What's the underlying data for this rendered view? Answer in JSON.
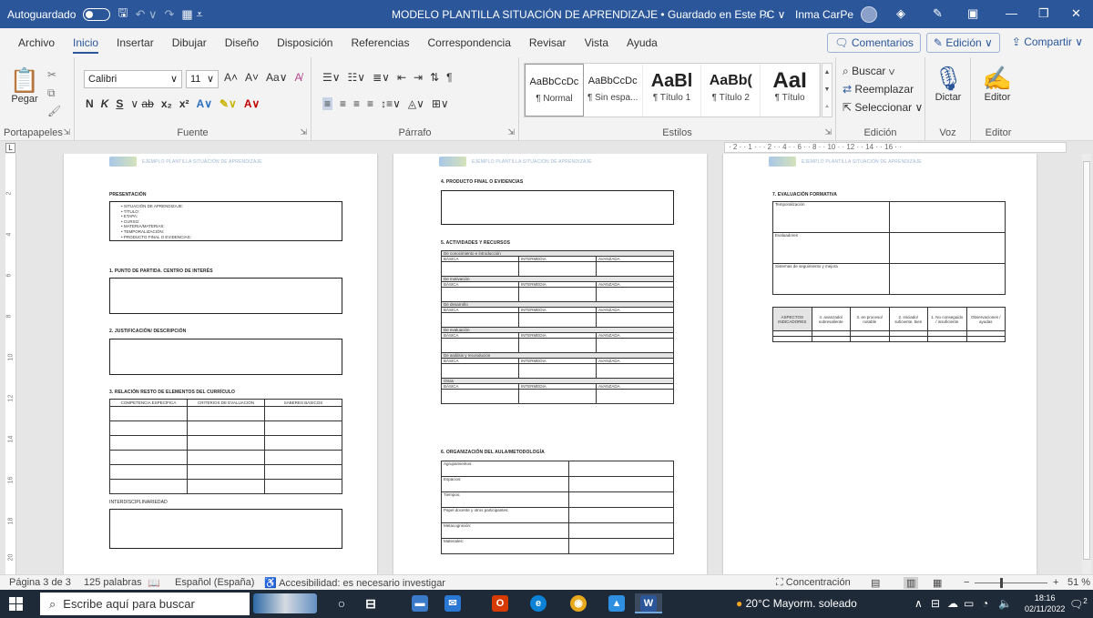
{
  "titlebar": {
    "autosave": "Autoguardado",
    "doc_title": "MODELO PLANTILLA SITUACIÓN DE APRENDIZAJE • Guardado en Este PC ∨",
    "user": "Inma CarPe"
  },
  "menu": {
    "tabs": [
      "Archivo",
      "Inicio",
      "Insertar",
      "Dibujar",
      "Diseño",
      "Disposición",
      "Referencias",
      "Correspondencia",
      "Revisar",
      "Vista",
      "Ayuda"
    ],
    "active": "Inicio",
    "comments": "Comentarios",
    "editing": "Edición ∨",
    "share": "Compartir ∨"
  },
  "ribbon": {
    "paste": "Pegar",
    "font_name": "Calibri",
    "font_size": "11",
    "styles": [
      {
        "preview": "AaBbCcDc",
        "name": "¶ Normal"
      },
      {
        "preview": "AaBbCcDc",
        "name": "¶ Sin espa..."
      },
      {
        "preview": "AaBl",
        "name": "¶ Título 1"
      },
      {
        "preview": "AaBb(",
        "name": "¶ Título 2"
      },
      {
        "preview": "AaI",
        "name": "¶ Título"
      }
    ],
    "find": "Buscar ∨",
    "replace": "Reemplazar",
    "select": "Seleccionar ∨",
    "dictate": "Dictar",
    "editor": "Editor",
    "groups": {
      "clipboard": "Portapapeles",
      "font": "Fuente",
      "paragraph": "Párrafo",
      "styles": "Estilos",
      "editing": "Edición",
      "voice": "Voz",
      "editor": "Editor"
    }
  },
  "ruler_text": "· 2 · · 1 · · · 2 · · 4 · · 6 · · 8 · · 10 · · 12 · · 14 · · 16 · ·",
  "document": {
    "header": "EJEMPLO PLANTILLA SITUACIÓN DE APRENDIZAJE",
    "page1": {
      "presentation": "PRESENTACIÓN",
      "list": [
        "SITUACIÓN DE APRENDIZAJE:",
        "TÍTULO:",
        "ETAPA:",
        "CURSO:",
        "MATERIA/MATERIAS:",
        "TEMPORALIZACIÓN:",
        "PRODUCTO FINAL O EVIDENCIAS:"
      ],
      "s1": "1. PUNTO DE PARTIDA. CENTRO DE INTERÉS",
      "s2": "2. JUSTIFICACIÓN/ DESCRIPCIÓN",
      "s3": "3. RELACIÓN RESTO DE ELEMENTOS DEL CURRÍCULO",
      "s3_cols": [
        "COMPETENCIA ESPECÍFICA",
        "CRITERIOS DE EVALUACIÓN",
        "SABERES BÁSICOS"
      ],
      "interdisc": "INTERDISCIPLINARIEDAD"
    },
    "page2": {
      "s4": "4. PRODUCTO FINAL O EVIDENCIAS",
      "s5": "5. ACTIVIDADES Y RECURSOS",
      "activity_groups": [
        "De conocimiento e introducción",
        "De motivación",
        "De desarrollo",
        "De evaluación",
        "De análisis y recondución",
        "Otras"
      ],
      "levels": [
        "BÁSICA",
        "INTERMEDIA",
        "AVANZADA"
      ],
      "s6": "6. ORGANIZACIÓN DEL AULA/METODOLOGÍA",
      "org_rows": [
        "Agrupamientos:",
        "Espacios:",
        "Tiempos:",
        "Papel docente y otros participantes:",
        "Metacognición:",
        "Materiales:"
      ]
    },
    "page3": {
      "s7": "7. EVALUACIÓN FORMATIVA",
      "eval_rows": [
        "Temporalización",
        "Evaluadores",
        "Sistemas de seguimiento y mejora"
      ],
      "rubric_cols": [
        "ASPECTOS INDICADORES",
        "4. avanzado/ sobresaliente",
        "3. en proceso/ notable",
        "2. iniciado/ suficiente, bien",
        "1. No conseguido / insuficiente",
        "Observaciones / ayudas"
      ]
    }
  },
  "status": {
    "page": "Página 3 de 3",
    "words": "125 palabras",
    "language": "Español (España)",
    "accessibility": "Accesibilidad: es necesario investigar",
    "focus": "Concentración",
    "zoom": "51 %"
  },
  "taskbar": {
    "search_placeholder": "Escribe aquí para buscar",
    "weather": "20°C  Mayorm. soleado",
    "time": "18:16",
    "date": "02/11/2022",
    "notif_count": "2"
  }
}
